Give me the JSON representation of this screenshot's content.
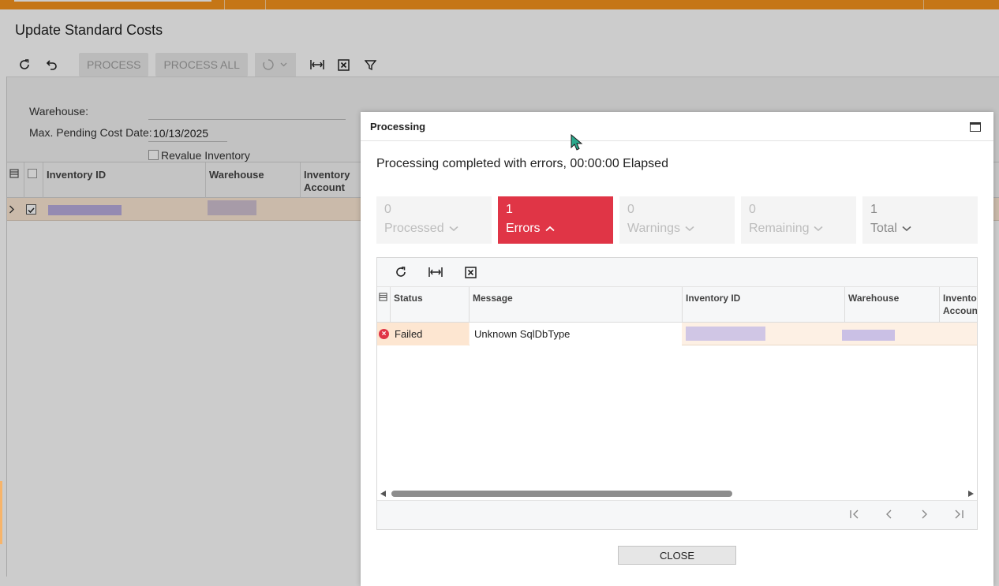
{
  "page": {
    "title": "Update Standard Costs",
    "toolbar": {
      "process_label": "PROCESS",
      "process_all_label": "PROCESS ALL"
    },
    "form": {
      "warehouse_label": "Warehouse:",
      "warehouse_value": "",
      "max_pending_label": "Max. Pending Cost Date:",
      "max_pending_value": "10/13/2025",
      "revalue_label": "Revalue Inventory"
    },
    "grid": {
      "columns": [
        "Inventory ID",
        "Warehouse",
        "Inventory\nAccount"
      ]
    }
  },
  "dialog": {
    "title": "Processing",
    "message": "Processing completed with errors, 00:00:00 Elapsed",
    "tiles": [
      {
        "count": "0",
        "label": "Processed"
      },
      {
        "count": "1",
        "label": "Errors"
      },
      {
        "count": "0",
        "label": "Warnings"
      },
      {
        "count": "0",
        "label": "Remaining"
      },
      {
        "count": "1",
        "label": "Total"
      }
    ],
    "grid": {
      "columns": [
        "Status",
        "Message",
        "Inventory ID",
        "Warehouse",
        "Inventory\nAccount"
      ],
      "rows": [
        {
          "status": "Failed",
          "message": "Unknown SqlDbType"
        }
      ]
    },
    "close_label": "CLOSE"
  },
  "colors": {
    "accent": "#f7941d",
    "error": "#e03546",
    "row_highlight": "#fde9d5"
  }
}
